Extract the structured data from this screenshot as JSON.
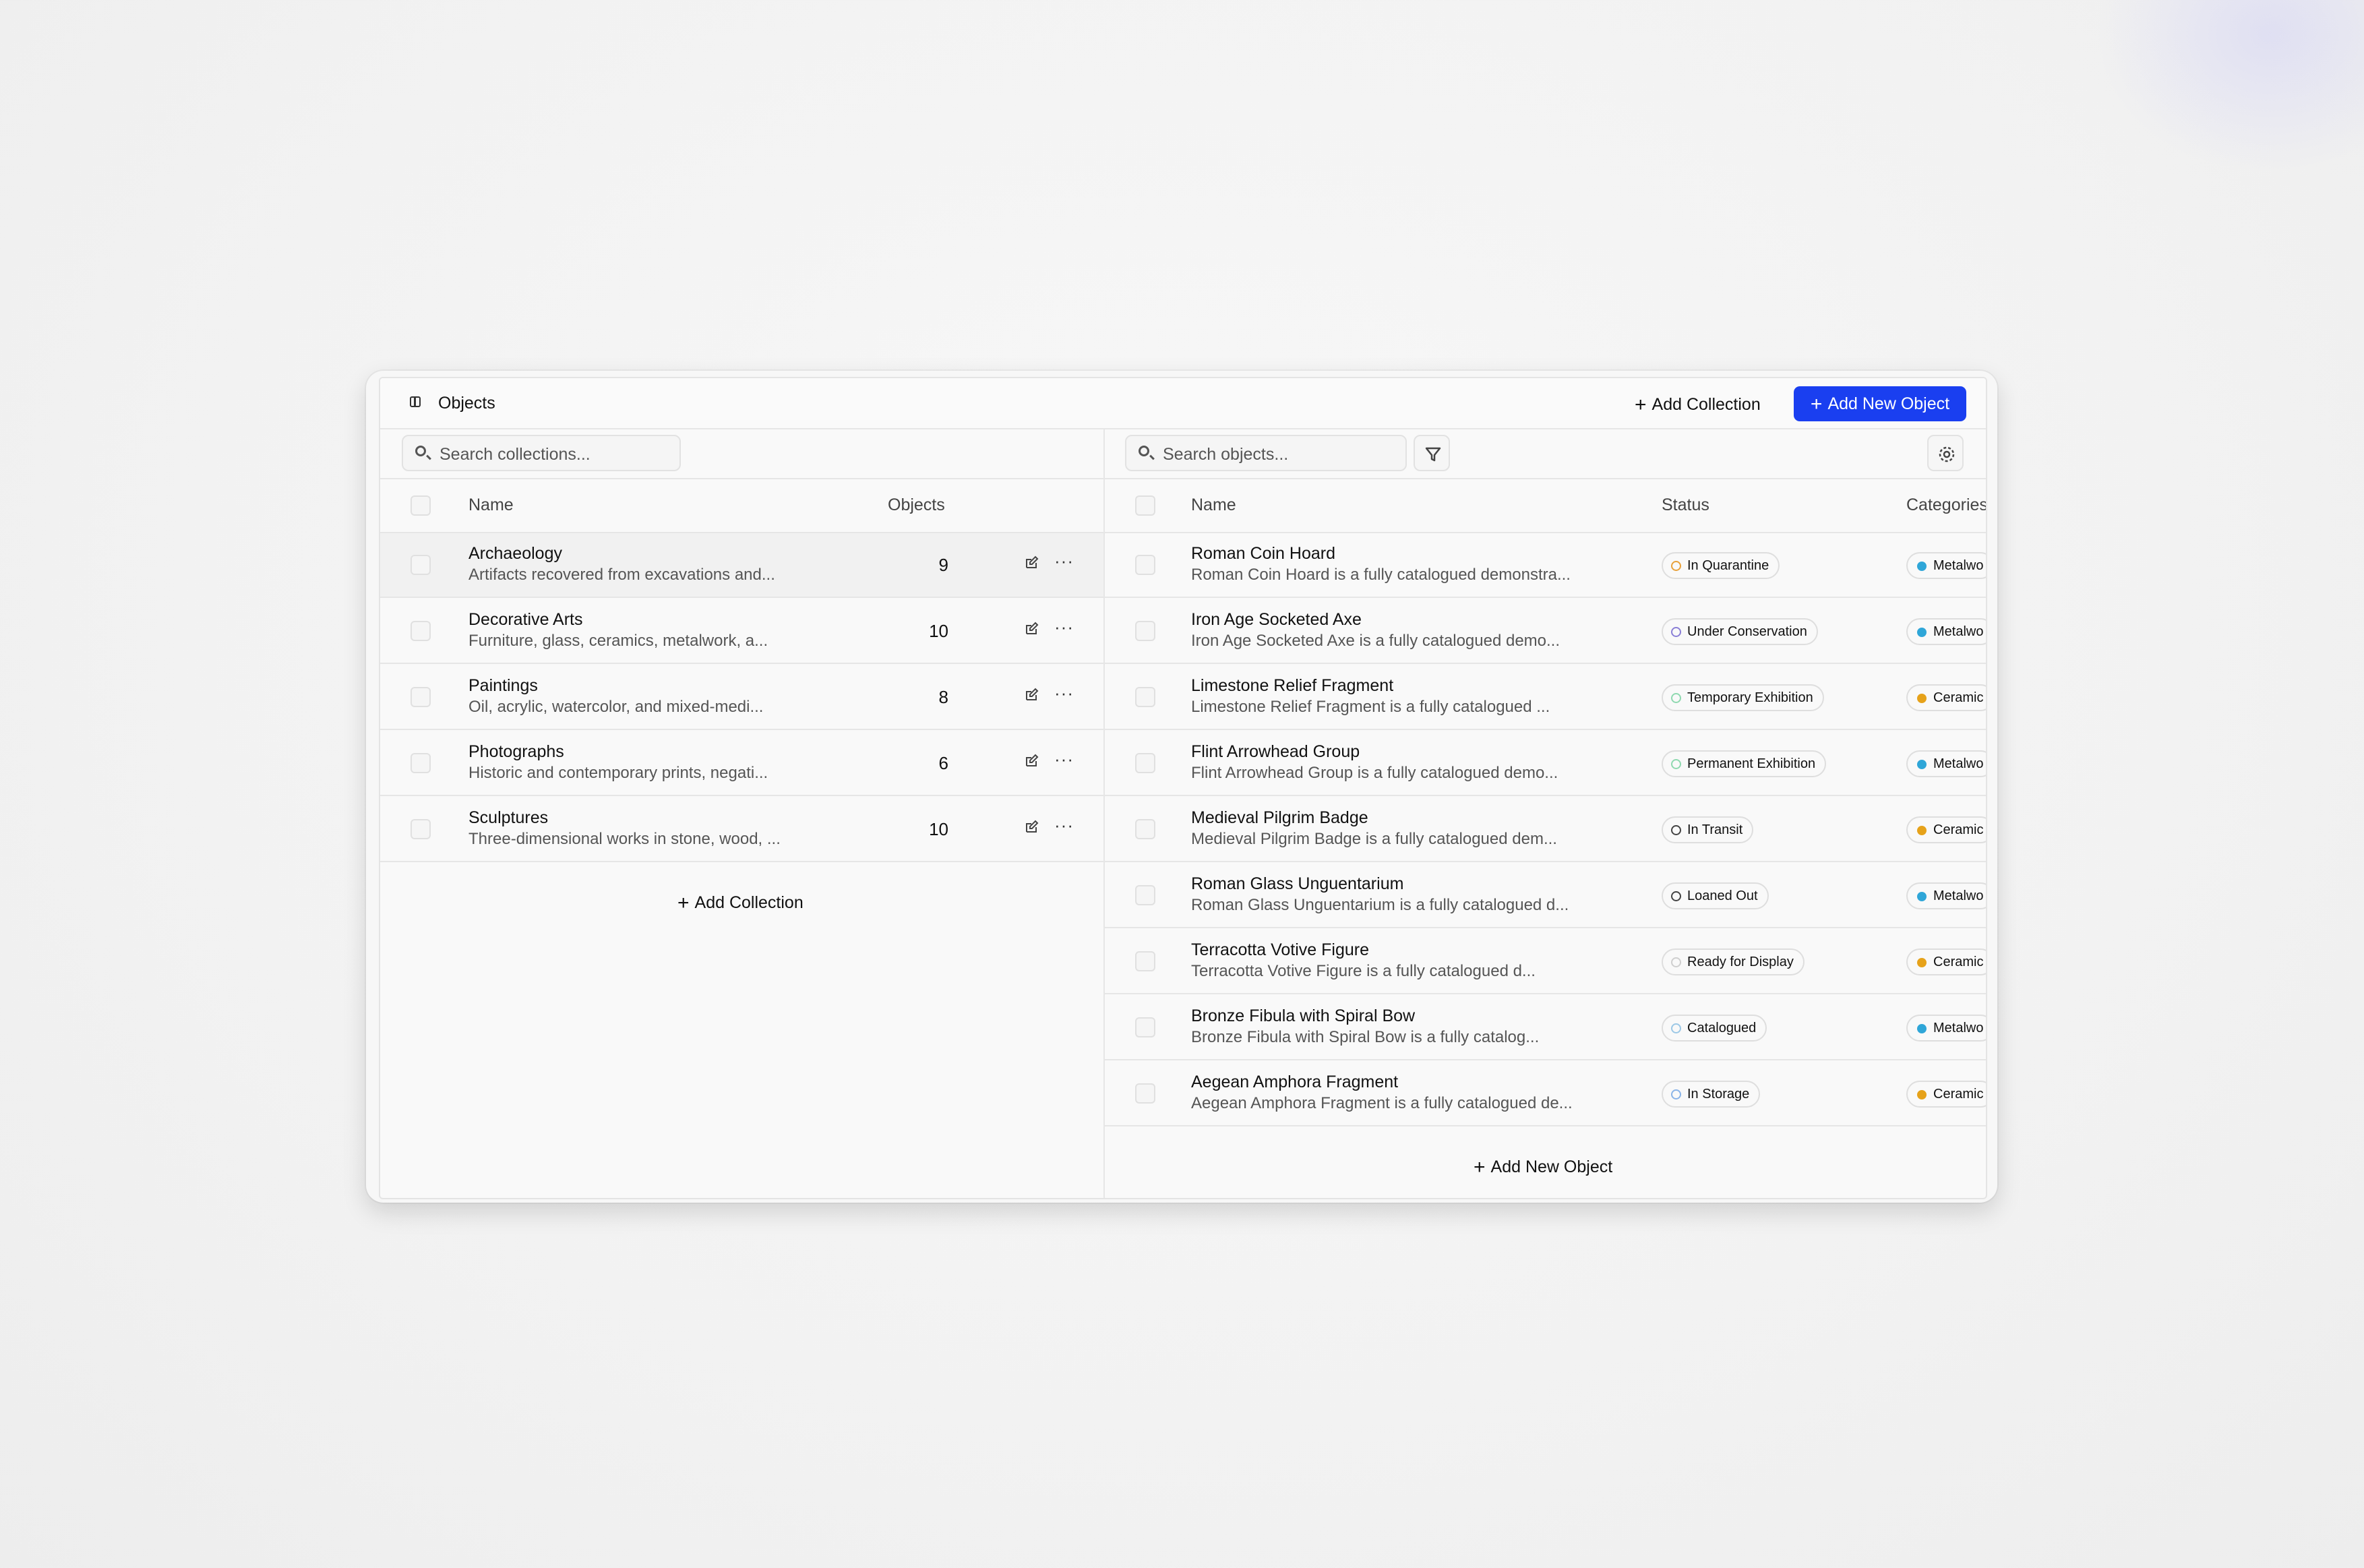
{
  "header": {
    "title": "Objects",
    "add_collection_label": "Add Collection",
    "add_object_label": "Add New Object"
  },
  "collections": {
    "search_placeholder": "Search collections...",
    "columns": {
      "name": "Name",
      "objects": "Objects"
    },
    "rows": [
      {
        "name": "Archaeology",
        "description": "Artifacts recovered from excavations and...",
        "count": "9"
      },
      {
        "name": "Decorative Arts",
        "description": "Furniture, glass, ceramics, metalwork, a...",
        "count": "10"
      },
      {
        "name": "Paintings",
        "description": "Oil, acrylic, watercolor, and mixed-medi...",
        "count": "8"
      },
      {
        "name": "Photographs",
        "description": "Historic and contemporary prints, negati...",
        "count": "6"
      },
      {
        "name": "Sculptures",
        "description": "Three-dimensional works in stone, wood, ...",
        "count": "10"
      }
    ],
    "add_label": "Add Collection"
  },
  "objects": {
    "search_placeholder": "Search objects...",
    "columns": {
      "name": "Name",
      "status": "Status",
      "categories": "Categories"
    },
    "rows": [
      {
        "name": "Roman Coin Hoard",
        "description": "Roman Coin Hoard is a fully catalogued demonstra...",
        "status": "In Quarantine",
        "category": "Metalwo"
      },
      {
        "name": "Iron Age Socketed Axe",
        "description": "Iron Age Socketed Axe is a fully catalogued demo...",
        "status": "Under Conservation",
        "category": "Metalwo"
      },
      {
        "name": "Limestone Relief Fragment",
        "description": "Limestone Relief Fragment is a fully catalogued ...",
        "status": "Temporary Exhibition",
        "category": "Ceramic"
      },
      {
        "name": "Flint Arrowhead Group",
        "description": "Flint Arrowhead Group is a fully catalogued demo...",
        "status": "Permanent Exhibition",
        "category": "Metalwo"
      },
      {
        "name": "Medieval Pilgrim Badge",
        "description": "Medieval Pilgrim Badge is a fully catalogued dem...",
        "status": "In Transit",
        "category": "Ceramic"
      },
      {
        "name": "Roman Glass Unguentarium",
        "description": "Roman Glass Unguentarium is a fully catalogued d...",
        "status": "Loaned Out",
        "category": "Metalwo"
      },
      {
        "name": "Terracotta Votive Figure",
        "description": "Terracotta Votive Figure is a fully catalogued d...",
        "status": "Ready for Display",
        "category": "Ceramic"
      },
      {
        "name": "Bronze Fibula with Spiral Bow",
        "description": "Bronze Fibula with Spiral Bow is a fully catalog...",
        "status": "Catalogued",
        "category": "Metalwo"
      },
      {
        "name": "Aegean Amphora Fragment",
        "description": "Aegean Amphora Fragment is a fully catalogued de...",
        "status": "In Storage",
        "category": "Ceramic"
      }
    ],
    "add_label": "Add New Object"
  },
  "colors": {
    "primary": "#1a3ff0",
    "metalwork_dot": "#2fa6d8",
    "ceramic_dot": "#e6a21a",
    "quarantine": "#e8a13a",
    "conservation": "#8a7fd6",
    "exhibition": "#8fd9b0",
    "transit": "#444444",
    "display": "#cfcfcf",
    "catalogued": "#9cc8e6",
    "storage": "#8ab4e8"
  }
}
